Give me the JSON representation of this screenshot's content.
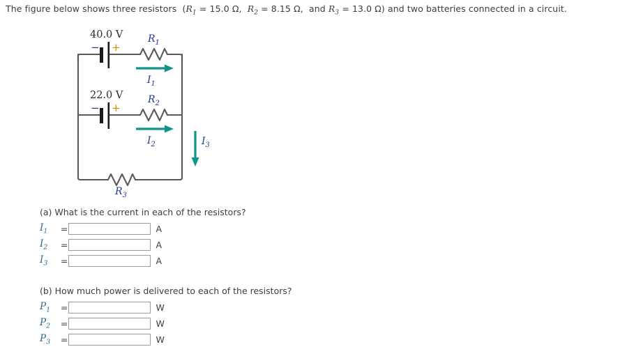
{
  "prompt": {
    "lead": "The figure below shows three resistors",
    "open_paren": "(",
    "r1_sym": "R",
    "r1_sub": "1",
    "r1_val": "= 15.0 Ω,",
    "r2_sym": "R",
    "r2_sub": "2",
    "r2_val": "= 8.15 Ω,",
    "and_word": "and",
    "r3_sym": "R",
    "r3_sub": "3",
    "r3_val": "= 13.0 Ω",
    "close_paren": ")",
    "tail": "and two batteries connected in a circuit."
  },
  "figure": {
    "battery1_label": "40.0 V",
    "battery1_minus": "−",
    "battery1_plus": "+",
    "battery2_label": "22.0 V",
    "battery2_minus": "−",
    "battery2_plus": "+",
    "r1_sym": "R",
    "r1_sub": "1",
    "r2_sym": "R",
    "r2_sub": "2",
    "r3_sym": "R",
    "r3_sub": "3",
    "i1_sym": "I",
    "i1_sub": "1",
    "i2_sym": "I",
    "i2_sub": "2",
    "i3_sym": "I",
    "i3_sub": "3",
    "colors": {
      "wire": "#595959",
      "arrow": "#11938c",
      "label_r": "#1f3a93",
      "label_v": "#2b2b2b",
      "plus": "#d98200",
      "minus": "#1f3a93"
    }
  },
  "sections": [
    {
      "question": "(a) What is the current in each of the resistors?",
      "rows": [
        {
          "sym": "I",
          "sub": "1",
          "eq": "=",
          "value": "",
          "unit": "A"
        },
        {
          "sym": "I",
          "sub": "2",
          "eq": "=",
          "value": "",
          "unit": "A"
        },
        {
          "sym": "I",
          "sub": "3",
          "eq": "=",
          "value": "",
          "unit": "A"
        }
      ]
    },
    {
      "question": "(b) How much power is delivered to each of the resistors?",
      "rows": [
        {
          "sym": "P",
          "sub": "1",
          "eq": "=",
          "value": "",
          "unit": "W"
        },
        {
          "sym": "P",
          "sub": "2",
          "eq": "=",
          "value": "",
          "unit": "W"
        },
        {
          "sym": "P",
          "sub": "3",
          "eq": "=",
          "value": "",
          "unit": "W"
        }
      ]
    }
  ]
}
